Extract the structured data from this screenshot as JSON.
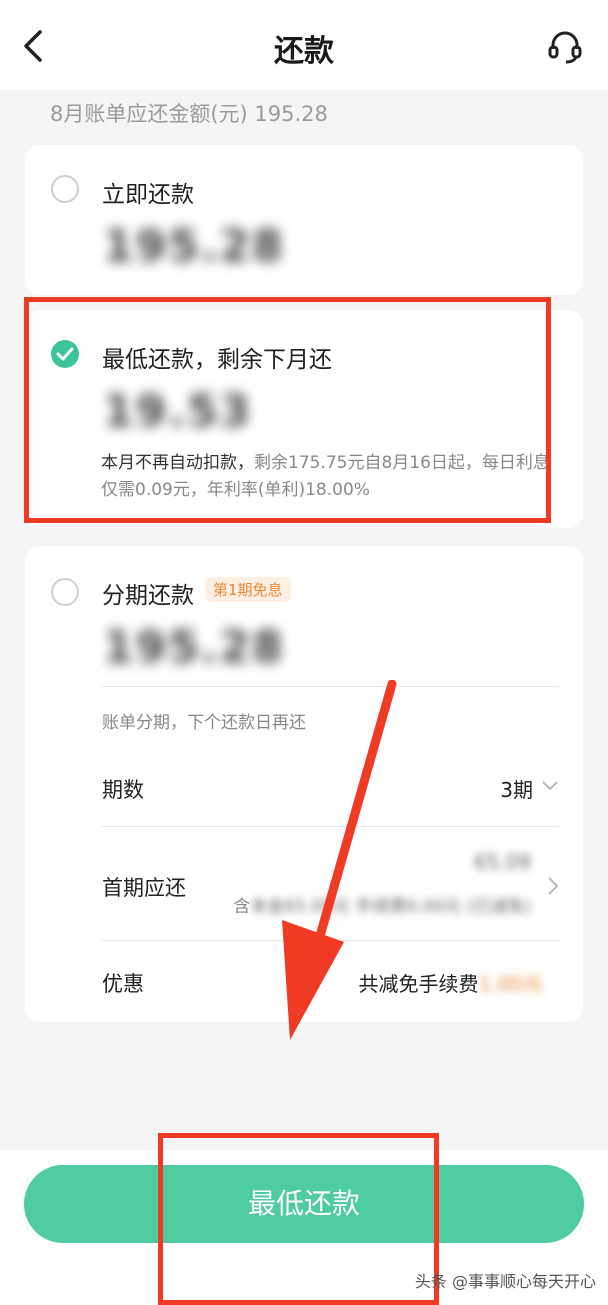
{
  "header": {
    "title": "还款"
  },
  "bill": {
    "summary": "8月账单应还金额(元) 195.28"
  },
  "options": {
    "now": {
      "title": "立即还款",
      "amount": "195.28"
    },
    "minimum": {
      "title": "最低还款，剩余下月还",
      "amount": "19.53",
      "desc_main": "本月不再自动扣款，",
      "desc_detail": "剩余175.75元自8月16日起，每日利息仅需0.09元，年利率(单利)18.00%"
    },
    "installment": {
      "title": "分期还款",
      "tag": "第1期免息",
      "amount": "195.28",
      "note": "账单分期，下个还款日再还",
      "rows": {
        "periods_label": "期数",
        "periods_value": "3期",
        "first_label": "首期应还",
        "first_amount": "65.09",
        "first_prefix": "含",
        "first_detail": "本金65.09元 手续费0.00元 (已减免)",
        "discount_label": "优惠",
        "discount_value": "共减免手续费",
        "discount_amount": "1.00元"
      }
    }
  },
  "footer": {
    "button_label": "最低还款",
    "watermark": "头条 @事事顺心每天开心"
  },
  "colors": {
    "accent": "#4ecb9f",
    "check": "#3ec49a",
    "annotation": "#ef3b24",
    "tag": "#e8883a"
  }
}
